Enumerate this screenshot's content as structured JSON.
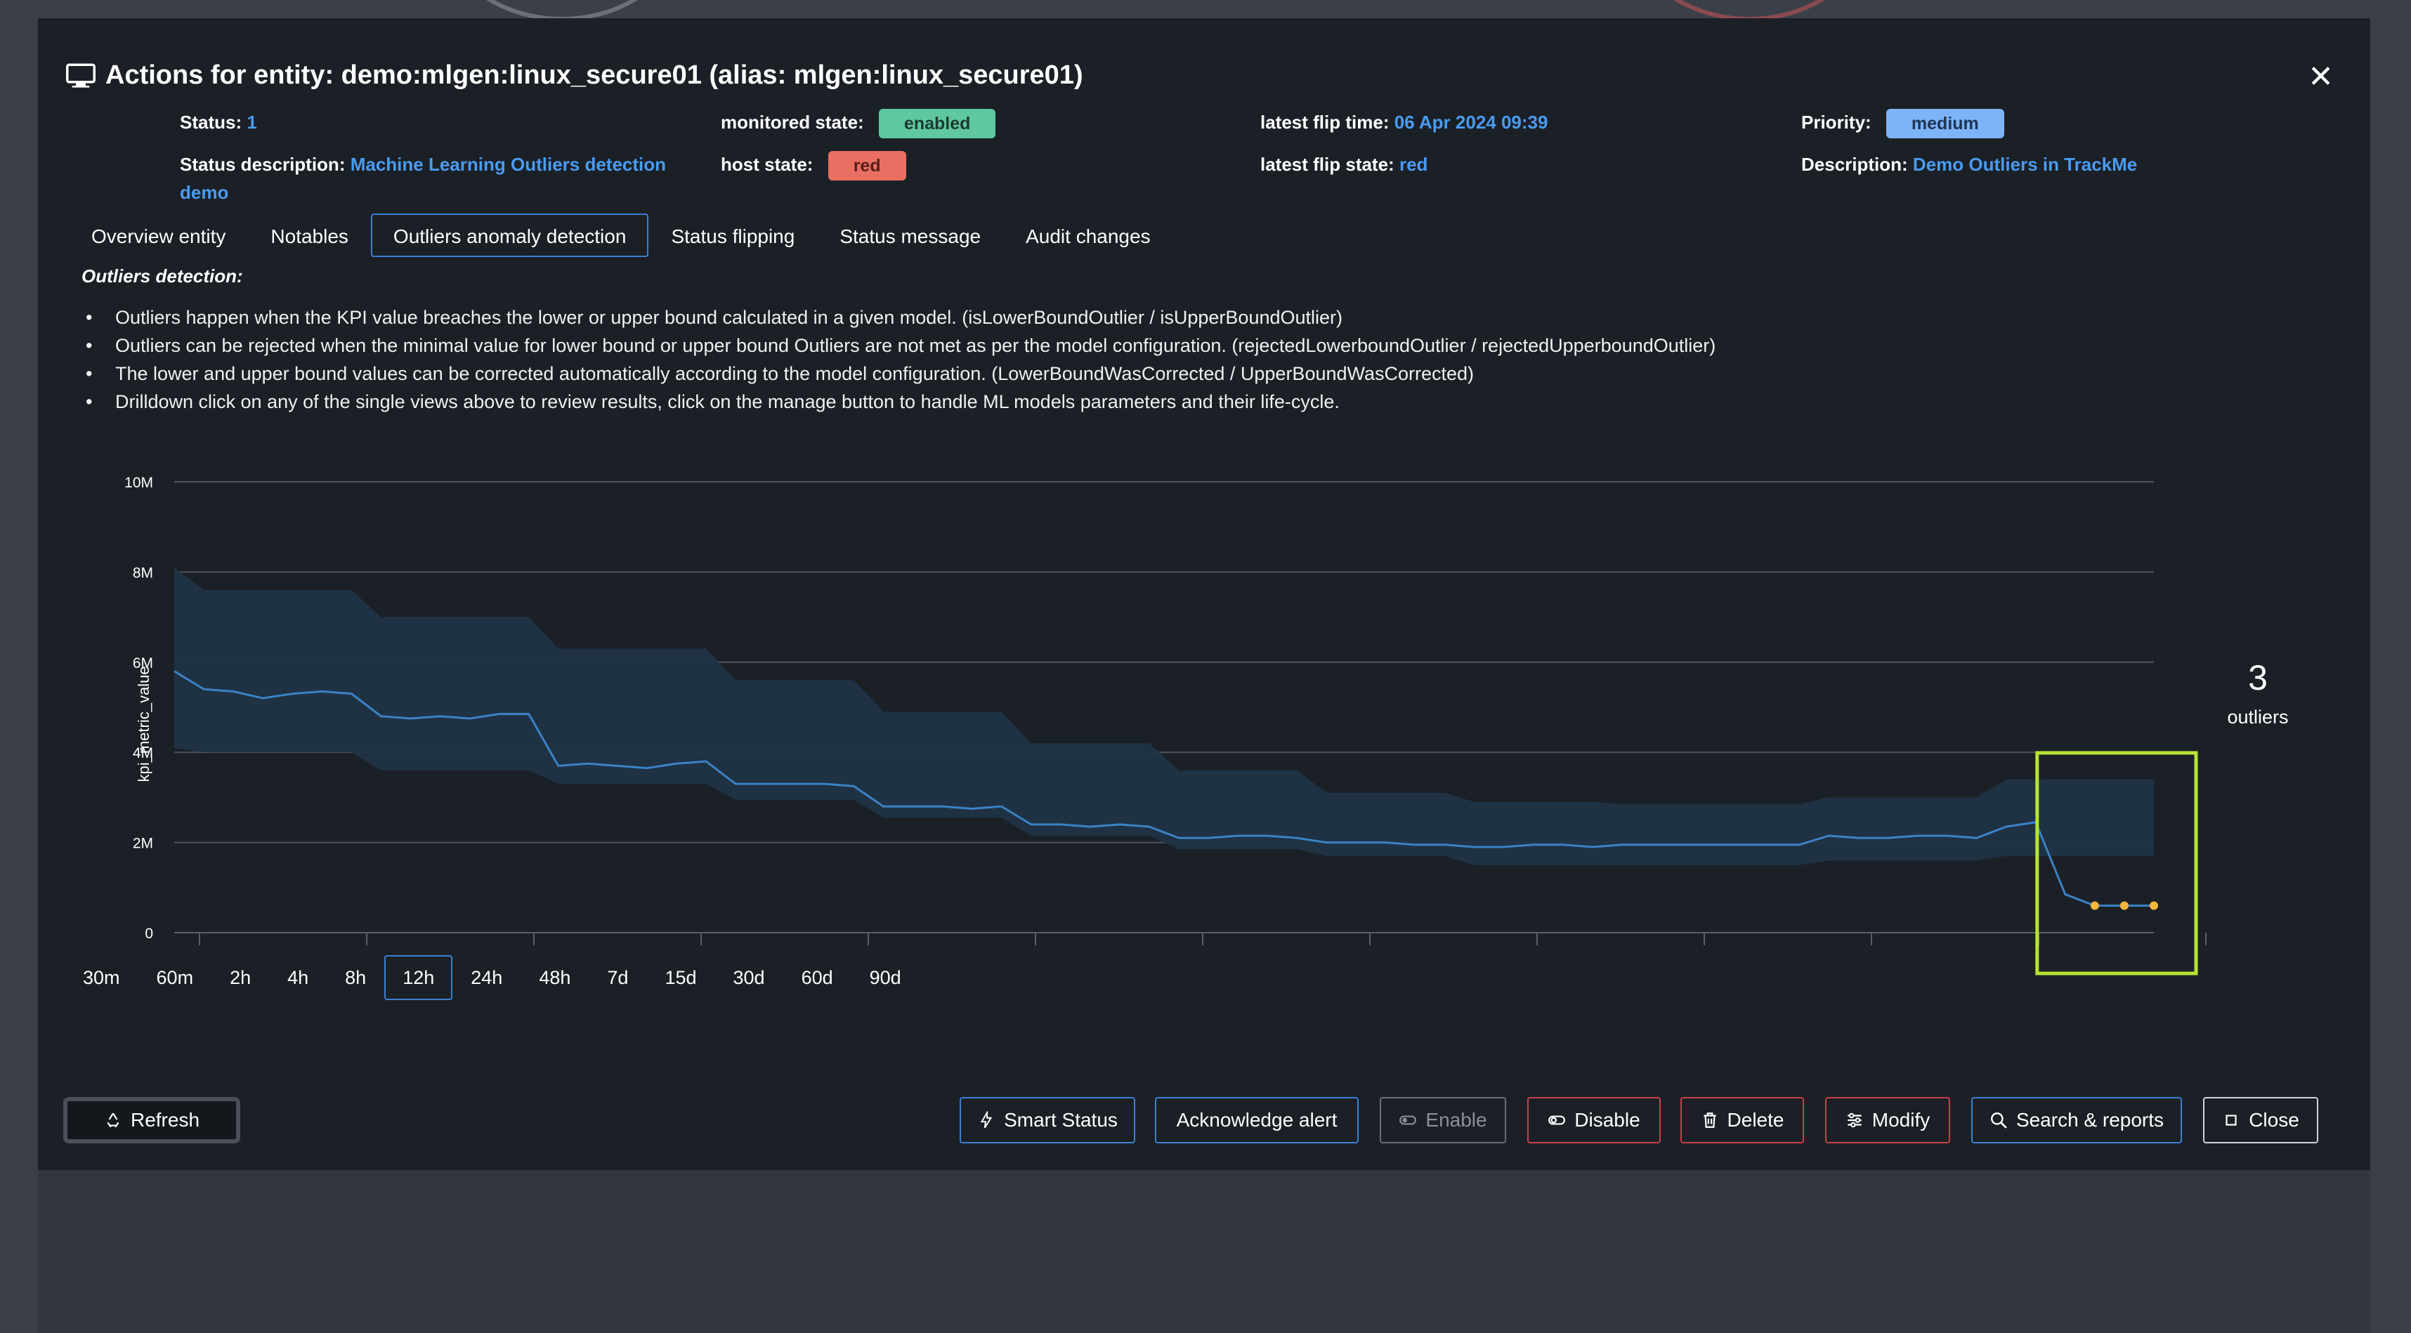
{
  "window": {
    "title": "Actions for entity: demo:mlgen:linux_secure01 (alias: mlgen:linux_secure01)",
    "close_symbol": "✕"
  },
  "meta": {
    "status_label": "Status:",
    "status_value": "1",
    "status_desc_label": "Status description:",
    "status_desc_value_line1": "Machine Learning Outliers detection",
    "status_desc_value_line2": "demo",
    "monitored_state_label": "monitored state:",
    "monitored_state_value": "enabled",
    "host_state_label": "host state:",
    "host_state_value": "red",
    "latest_flip_time_label": "latest flip time:",
    "latest_flip_time_value": "06 Apr 2024 09:39",
    "latest_flip_state_label": "latest flip state:",
    "latest_flip_state_value": "red",
    "priority_label": "Priority:",
    "priority_value": "medium",
    "description_label": "Description:",
    "description_value": "Demo Outliers in TrackMe"
  },
  "colors": {
    "enabled_pill": "#5fc8a0",
    "red_pill": "#ea6f63",
    "medium_pill": "#7db4f7",
    "accent": "#3d7fd4",
    "link": "#4a9bf0",
    "band": "#1f3446",
    "line": "#3b82c4",
    "outlier": "#f5b63b",
    "highlight": "#b6e334"
  },
  "tabs": [
    {
      "label": "Overview entity",
      "active": false
    },
    {
      "label": "Notables",
      "active": false
    },
    {
      "label": "Outliers anomaly detection",
      "active": true
    },
    {
      "label": "Status flipping",
      "active": false
    },
    {
      "label": "Status message",
      "active": false
    },
    {
      "label": "Audit changes",
      "active": false
    }
  ],
  "content": {
    "heading": "Outliers detection:",
    "bullets": [
      "Outliers happen when the KPI value breaches the lower or upper bound calculated in a given model. (isLowerBoundOutlier / isUpperBoundOutlier)",
      "Outliers can be rejected when the minimal value for lower bound or upper bound Outliers are not met as per the model configuration. (rejectedLowerboundOutlier / rejectedUpperboundOutlier)",
      "The lower and upper bound values can be corrected automatically according to the model configuration. (LowerBoundWasCorrected / UpperBoundWasCorrected)",
      "Drilldown click on any of the single views above to review results, click on the manage button to handle ML models parameters and their life-cycle."
    ]
  },
  "chart_data": {
    "type": "area",
    "ylabel": "kpi_metric_value",
    "ylim": [
      0,
      10000000
    ],
    "yticks": [
      {
        "value": 0,
        "label": "0"
      },
      {
        "value": 2000000,
        "label": "2M"
      },
      {
        "value": 4000000,
        "label": "4M"
      },
      {
        "value": 6000000,
        "label": "6M"
      },
      {
        "value": 8000000,
        "label": "8M"
      },
      {
        "value": 10000000,
        "label": "10M"
      }
    ],
    "grid": true,
    "n_points": 72,
    "kpi": [
      5800000,
      5400000,
      5350000,
      5200000,
      5300000,
      5350000,
      5300000,
      4800000,
      4750000,
      4800000,
      4750000,
      4850000,
      4850000,
      3700000,
      3750000,
      3700000,
      3650000,
      3750000,
      3800000,
      3300000,
      3300000,
      3300000,
      3300000,
      3250000,
      2800000,
      2800000,
      2800000,
      2750000,
      2800000,
      2400000,
      2400000,
      2350000,
      2400000,
      2350000,
      2100000,
      2100000,
      2150000,
      2150000,
      2100000,
      2000000,
      2000000,
      2000000,
      1950000,
      1950000,
      1900000,
      1900000,
      1950000,
      1950000,
      1900000,
      1950000,
      1950000,
      1950000,
      1950000,
      1950000,
      1950000,
      1950000,
      2150000,
      2100000,
      2100000,
      2150000,
      2150000,
      2100000,
      2350000,
      2450000,
      850000,
      600000,
      600000,
      600000
    ],
    "lower_bound": [
      4100000,
      4000000,
      4000000,
      4000000,
      4000000,
      4000000,
      4000000,
      3600000,
      3600000,
      3600000,
      3600000,
      3600000,
      3600000,
      3300000,
      3300000,
      3300000,
      3300000,
      3300000,
      3300000,
      2950000,
      2950000,
      2950000,
      2950000,
      2950000,
      2550000,
      2550000,
      2550000,
      2550000,
      2550000,
      2150000,
      2150000,
      2150000,
      2150000,
      2150000,
      1850000,
      1850000,
      1850000,
      1850000,
      1850000,
      1700000,
      1700000,
      1700000,
      1700000,
      1700000,
      1500000,
      1500000,
      1500000,
      1500000,
      1500000,
      1500000,
      1500000,
      1500000,
      1500000,
      1500000,
      1500000,
      1500000,
      1600000,
      1600000,
      1600000,
      1600000,
      1600000,
      1600000,
      1700000,
      1700000,
      1700000,
      1700000,
      1700000,
      1700000
    ],
    "upper_bound": [
      8100000,
      7600000,
      7600000,
      7600000,
      7600000,
      7600000,
      7600000,
      7000000,
      7000000,
      7000000,
      7000000,
      7000000,
      7000000,
      6300000,
      6300000,
      6300000,
      6300000,
      6300000,
      6300000,
      5600000,
      5600000,
      5600000,
      5600000,
      5600000,
      4900000,
      4900000,
      4900000,
      4900000,
      4900000,
      4200000,
      4200000,
      4200000,
      4200000,
      4200000,
      3600000,
      3600000,
      3600000,
      3600000,
      3600000,
      3100000,
      3100000,
      3100000,
      3100000,
      3100000,
      2900000,
      2900000,
      2900000,
      2900000,
      2900000,
      2850000,
      2850000,
      2850000,
      2850000,
      2850000,
      2850000,
      2850000,
      3000000,
      3000000,
      3000000,
      3000000,
      3000000,
      3000000,
      3400000,
      3400000,
      3400000,
      3400000,
      3400000,
      3400000
    ],
    "outlier_indices": [
      64,
      65,
      66,
      67
    ],
    "outliers_count": "3",
    "outliers_label": "outliers"
  },
  "ranges": [
    {
      "label": "30m",
      "active": false
    },
    {
      "label": "60m",
      "active": false
    },
    {
      "label": "2h",
      "active": false
    },
    {
      "label": "4h",
      "active": false
    },
    {
      "label": "8h",
      "active": false
    },
    {
      "label": "12h",
      "active": true
    },
    {
      "label": "24h",
      "active": false
    },
    {
      "label": "48h",
      "active": false
    },
    {
      "label": "7d",
      "active": false
    },
    {
      "label": "15d",
      "active": false
    },
    {
      "label": "30d",
      "active": false
    },
    {
      "label": "60d",
      "active": false
    },
    {
      "label": "90d",
      "active": false
    }
  ],
  "buttons": {
    "refresh": "Refresh",
    "smart_status": "Smart Status",
    "acknowledge": "Acknowledge alert",
    "enable": "Enable",
    "disable": "Disable",
    "delete": "Delete",
    "modify": "Modify",
    "search": "Search & reports",
    "close": "Close"
  }
}
